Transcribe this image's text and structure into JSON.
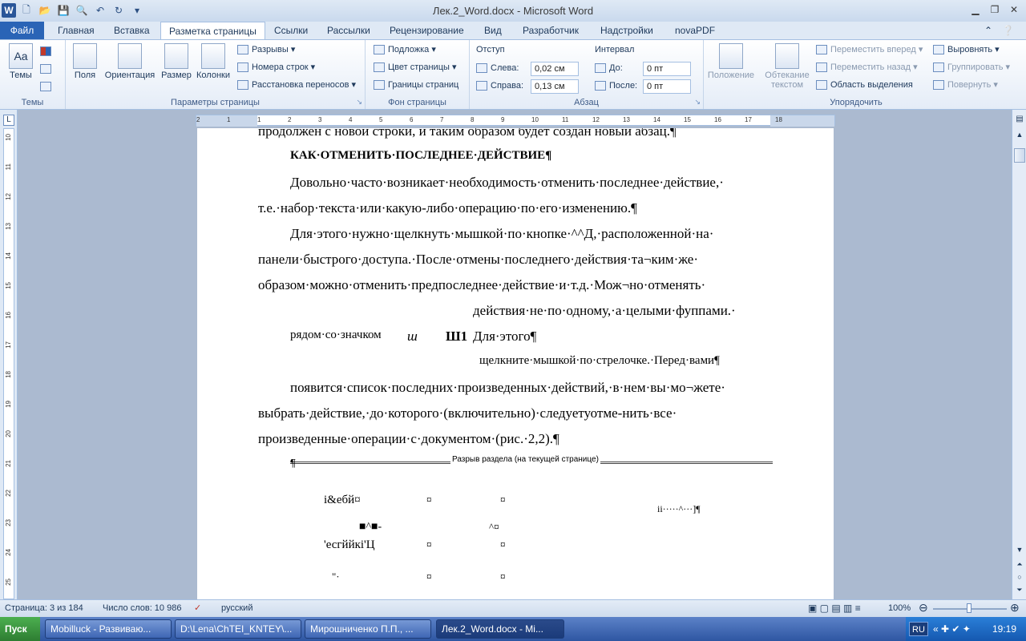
{
  "window": {
    "title": "Лек.2_Word.docx - Microsoft Word"
  },
  "tabs": [
    "Файл",
    "Главная",
    "Вставка",
    "Разметка страницы",
    "Ссылки",
    "Рассылки",
    "Рецензирование",
    "Вид",
    "Разработчик",
    "Надстройки",
    "novaPDF"
  ],
  "ribbon": {
    "themes": {
      "label": "Темы",
      "group": "Темы"
    },
    "page_setup": {
      "group": "Параметры страницы",
      "fields": "Поля",
      "orientation": "Ориентация",
      "size": "Размер",
      "columns": "Колонки",
      "breaks": "Разрывы",
      "line_numbers": "Номера строк",
      "hyphenation": "Расстановка переносов"
    },
    "page_bg": {
      "group": "Фон страницы",
      "watermark": "Подложка",
      "page_color": "Цвет страницы",
      "page_borders": "Границы страниц"
    },
    "paragraph": {
      "group": "Абзац",
      "indent": "Отступ",
      "left": "Слева:",
      "right": "Справа:",
      "left_val": "0,02 см",
      "right_val": "0,13 см",
      "spacing": "Интервал",
      "before": "До:",
      "after": "После:",
      "before_val": "0 пт",
      "after_val": "0 пт"
    },
    "arrange": {
      "group": "Упорядочить",
      "position": "Положение",
      "wrap": "Обтекание текстом",
      "bring_forward": "Переместить вперед",
      "send_backward": "Переместить назад",
      "selection_pane": "Область выделения",
      "align": "Выровнять",
      "group_btn": "Группировать",
      "rotate": "Повернуть"
    }
  },
  "ruler": [
    "2",
    "1",
    "1",
    "2",
    "3",
    "4",
    "5",
    "6",
    "7",
    "8",
    "9",
    "10",
    "11",
    "12",
    "13",
    "14",
    "15",
    "16",
    "17",
    "18"
  ],
  "vruler": [
    "10",
    "11",
    "12",
    "13",
    "14",
    "15",
    "16",
    "17",
    "18",
    "19",
    "20",
    "21",
    "22",
    "23",
    "24",
    "25"
  ],
  "doc": {
    "l0": "продолжен с новой строки, и таким образом будет создан новый абзац.¶",
    "heading": "КАК·ОТМЕНИТЬ·ПОСЛЕДНЕЕ·ДЕЙСТВИЕ¶",
    "p1a": "Довольно·часто·возникает·необходимость·отменить·последнее·действие,·",
    "p1b": "т.е.·набор·текста·или·какую-либо·операцию·по·его·изменению.¶",
    "p2a": "Для·этого·нужно·щелкнуть·мышкой·по·кнопке·^^Д,·расположенной·на·",
    "p2b": "панели·быстрого·доступа.·После·отмены·последнего·действия·та¬ким·же·",
    "p2c": "образом·можно·отменить·предпоследнее·действие·и·т.д.·Мож¬но·отменять·",
    "p2d": "действия·не·по·одному,·а·целыми·фуппами.·",
    "p3a": "рядом·со·значком",
    "p3b": "ш",
    "p3c": "Ш1",
    "p3d": "Для·этого¶",
    "p4": "щелкните·мышкой·по·стрелочке.·Перед·вами¶",
    "p5a": "появится·список·последних·произведенных·действий,·в·нем·вы·мо¬жете·",
    "p5b": "выбрать·действие,·до·которого·(включительно)·следуетуотме-нить·все·",
    "p5c": "произведенные·операции·с·документом·(рис.·2,2).¶",
    "section_break": "Разрыв раздела (на текущей странице)",
    "t1": "i&ебй¤",
    "t2": "¤",
    "t3": "¤",
    "t4": "ii·····^···]¶",
    "t5": "■^■-",
    "t6": "^¤",
    "t7": "'есгййкі'Ц",
    "t8": "¤",
    "t9": "¤",
    "t10": "\"·",
    "t11": "¤",
    "t12": "¤"
  },
  "status": {
    "page": "Страница: 3 из 184",
    "words": "Число слов: 10 986",
    "lang": "русский",
    "zoom": "100%"
  },
  "taskbar": {
    "start": "Пуск",
    "items": [
      "Mobilluck - Развиваю...",
      "D:\\Lena\\ChTEI_KNTEY\\...",
      "Мирошниченко П.П., ...",
      "Лек.2_Word.docx - Mi..."
    ],
    "lang": "RU",
    "time": "19:19"
  }
}
